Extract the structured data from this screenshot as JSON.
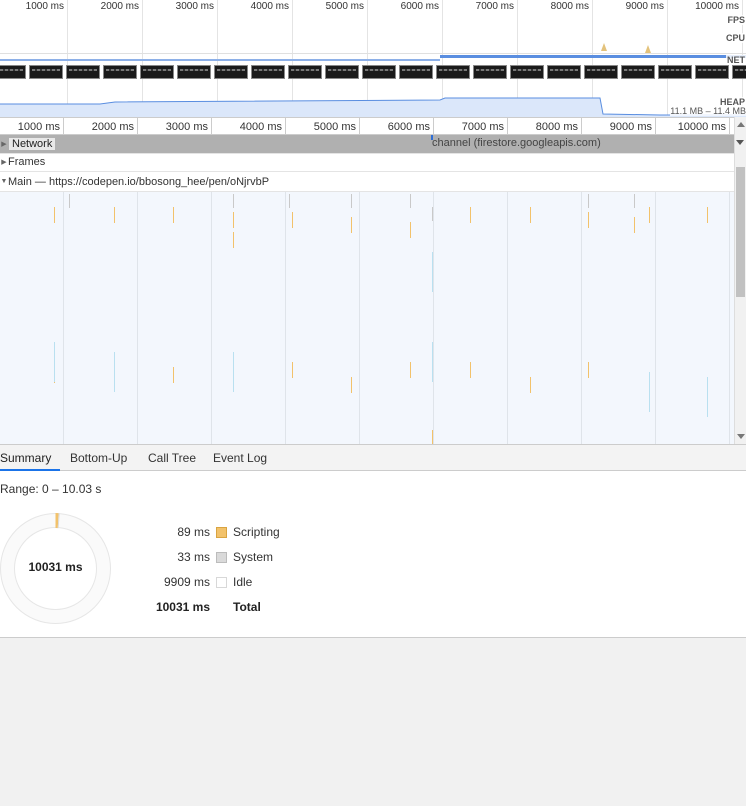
{
  "overview": {
    "ticks": [
      "1000 ms",
      "2000 ms",
      "3000 ms",
      "4000 ms",
      "5000 ms",
      "6000 ms",
      "7000 ms",
      "8000 ms",
      "9000 ms",
      "10000 ms"
    ],
    "rows": {
      "fps": "FPS",
      "cpu": "CPU",
      "net": "NET",
      "heap": "HEAP"
    },
    "heap_range": "11.1 MB – 11.4 MB",
    "colors": {
      "cpu": "#e3c27b",
      "net": "#5a8ee0",
      "heap": "#5a8ee0"
    }
  },
  "ruler": {
    "ticks": [
      "1000 ms",
      "2000 ms",
      "3000 ms",
      "4000 ms",
      "5000 ms",
      "6000 ms",
      "7000 ms",
      "8000 ms",
      "9000 ms",
      "10000 ms"
    ]
  },
  "tracks": {
    "network_label": "Network",
    "network_request": "channel (firestore.googleapis.com)",
    "frames_label": "Frames",
    "main_label": "Main — https://codepen.io/bbosong_hee/pen/oNjrvbP"
  },
  "tabs": [
    {
      "label": "Summary",
      "active": true
    },
    {
      "label": "Bottom-Up",
      "active": false
    },
    {
      "label": "Call Tree",
      "active": false
    },
    {
      "label": "Event Log",
      "active": false
    }
  ],
  "summary": {
    "range": "Range: 0 – 10.03 s",
    "total_center": "10031 ms",
    "items": [
      {
        "value": "89 ms",
        "name": "Scripting",
        "color": "#f2c26b",
        "border": "#d9a441",
        "ms": 89
      },
      {
        "value": "33 ms",
        "name": "System",
        "color": "#dadada",
        "border": "#bcbcbc",
        "ms": 33
      },
      {
        "value": "9909 ms",
        "name": "Idle",
        "color": "#ffffff",
        "border": "#d8d8d8",
        "ms": 9909
      }
    ],
    "total": {
      "value": "10031 ms",
      "name": "Total"
    }
  }
}
